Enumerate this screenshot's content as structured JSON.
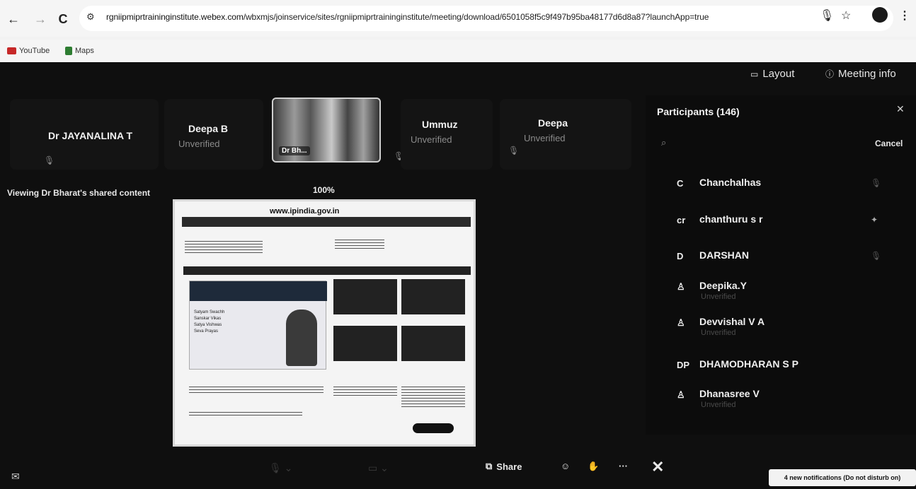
{
  "browser": {
    "back": "←",
    "forward": "→",
    "reload": "C",
    "url_domain": "rgniipmiprtraininginstitute.webex.com",
    "url_path": "/wbxmjs/joinservice/sites/rgniipmiprtraininginstitute/meeting/download/6501058f5c9f497b95ba48177d6d8a87?launchApp=true",
    "bookmarks": [
      {
        "label": "YouTube",
        "color": "#e53935"
      },
      {
        "label": "Maps",
        "color": "#34a853"
      }
    ]
  },
  "meeting": {
    "layout_label": "Layout",
    "meeting_info_label": "Meeting info",
    "tiles": [
      {
        "name": "Dr JAYANALINA T",
        "status": ""
      },
      {
        "name": "Deepa B",
        "status": "Unverified"
      },
      {
        "name": "Ummuz",
        "status": "Unverified"
      },
      {
        "name": "Deepa",
        "status": "Unverified"
      }
    ],
    "video_tile_label": "Dr Bh...",
    "viewing_text": "Viewing Dr Bharat's shared content",
    "zoom": "100%",
    "shared_site_title": "www.ipindia.gov.in",
    "shared_hero_lines": [
      "Satyam Swachh",
      "Sanskar Vikas",
      "Satya Vishwas",
      "Seva Prayas"
    ]
  },
  "participants": {
    "title": "Participants (146)",
    "cancel_label": "Cancel",
    "list": [
      {
        "avatar": "C",
        "name": "Chanchalhas",
        "sub": ""
      },
      {
        "avatar": "cr",
        "name": "chanthuru s r",
        "sub": ""
      },
      {
        "avatar": "D",
        "name": "DARSHAN",
        "sub": ""
      },
      {
        "avatar": "person",
        "name": "Deepika.Y",
        "sub": "Unverified"
      },
      {
        "avatar": "person",
        "name": "Devvishal V A",
        "sub": "Unverified"
      },
      {
        "avatar": "DP",
        "name": "DHAMODHARAN S P",
        "sub": ""
      },
      {
        "avatar": "person",
        "name": "Dhanasree V",
        "sub": "Unverified"
      }
    ]
  },
  "toolbar": {
    "share_label": "Share",
    "end_label": "✕",
    "more_label": "···",
    "notification": "4 new notifications (Do not disturb on)"
  }
}
